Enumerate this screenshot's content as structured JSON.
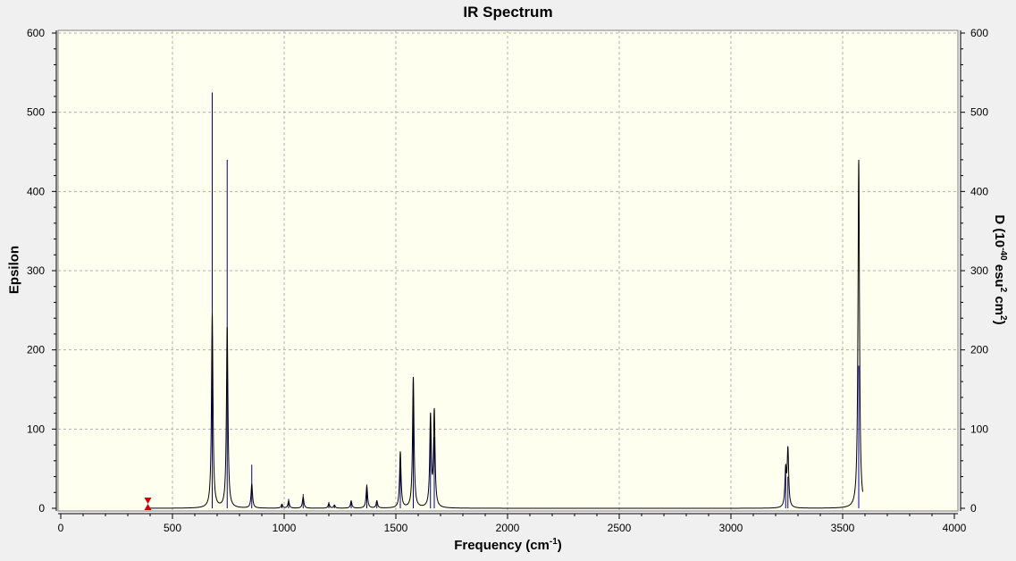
{
  "chart_data": {
    "type": "line",
    "title": "IR Spectrum",
    "xlabel": "Frequency (cm-1)",
    "xlabel_parts": {
      "main": "Frequency (cm",
      "sup": "-1",
      "tail": ")"
    },
    "ylabel": "Epsilon",
    "y2label": "D (10-40 esu2 cm2)",
    "y2label_parts": {
      "a": "D (10",
      "sup1": "-40",
      "b": " esu",
      "sup2": "2",
      "c": " cm",
      "sup3": "2",
      "d": ")"
    },
    "xlim": [
      0,
      4000
    ],
    "ylim": [
      0,
      600
    ],
    "y2lim": [
      0,
      600
    ],
    "xticks": [
      0,
      500,
      1000,
      1500,
      2000,
      2500,
      3000,
      3500,
      4000
    ],
    "yticks": [
      0,
      100,
      200,
      300,
      400,
      500,
      600
    ],
    "y2ticks": [
      0,
      100,
      200,
      300,
      400,
      500,
      600
    ],
    "grid": true,
    "series": [
      {
        "role": "spectrum",
        "peaks": [
          {
            "freq": 678,
            "height": 245
          },
          {
            "freq": 745,
            "height": 228
          },
          {
            "freq": 855,
            "height": 30
          },
          {
            "freq": 990,
            "height": 5
          },
          {
            "freq": 1020,
            "height": 9
          },
          {
            "freq": 1085,
            "height": 14
          },
          {
            "freq": 1200,
            "height": 6
          },
          {
            "freq": 1225,
            "height": 4
          },
          {
            "freq": 1300,
            "height": 9
          },
          {
            "freq": 1370,
            "height": 28
          },
          {
            "freq": 1415,
            "height": 9
          },
          {
            "freq": 1520,
            "height": 70
          },
          {
            "freq": 1578,
            "height": 165
          },
          {
            "freq": 1655,
            "height": 114
          },
          {
            "freq": 1672,
            "height": 120
          },
          {
            "freq": 3245,
            "height": 45
          },
          {
            "freq": 3255,
            "height": 72
          },
          {
            "freq": 3572,
            "height": 440
          }
        ],
        "x_range": [
          380,
          3590
        ]
      },
      {
        "role": "intensity-sticks",
        "sticks": [
          {
            "freq": 678,
            "value": 525
          },
          {
            "freq": 745,
            "value": 440
          },
          {
            "freq": 855,
            "value": 55
          },
          {
            "freq": 990,
            "value": 5
          },
          {
            "freq": 1020,
            "value": 12
          },
          {
            "freq": 1085,
            "value": 18
          },
          {
            "freq": 1200,
            "value": 8
          },
          {
            "freq": 1225,
            "value": 4
          },
          {
            "freq": 1300,
            "value": 10
          },
          {
            "freq": 1370,
            "value": 30
          },
          {
            "freq": 1415,
            "value": 10
          },
          {
            "freq": 1520,
            "value": 72
          },
          {
            "freq": 1578,
            "value": 130
          },
          {
            "freq": 1655,
            "value": 115
          },
          {
            "freq": 1672,
            "value": 90
          },
          {
            "freq": 3245,
            "value": 50
          },
          {
            "freq": 3255,
            "value": 40
          },
          {
            "freq": 3572,
            "value": 180
          }
        ]
      }
    ],
    "marker": {
      "freq": 390,
      "shape": "red-triangle-pair"
    },
    "colors": {
      "plot_bg": "#fffff0",
      "spectrum": "#000000",
      "sticks": "#00008b",
      "grid": "#b0b0b0",
      "marker": "#d00000"
    }
  }
}
